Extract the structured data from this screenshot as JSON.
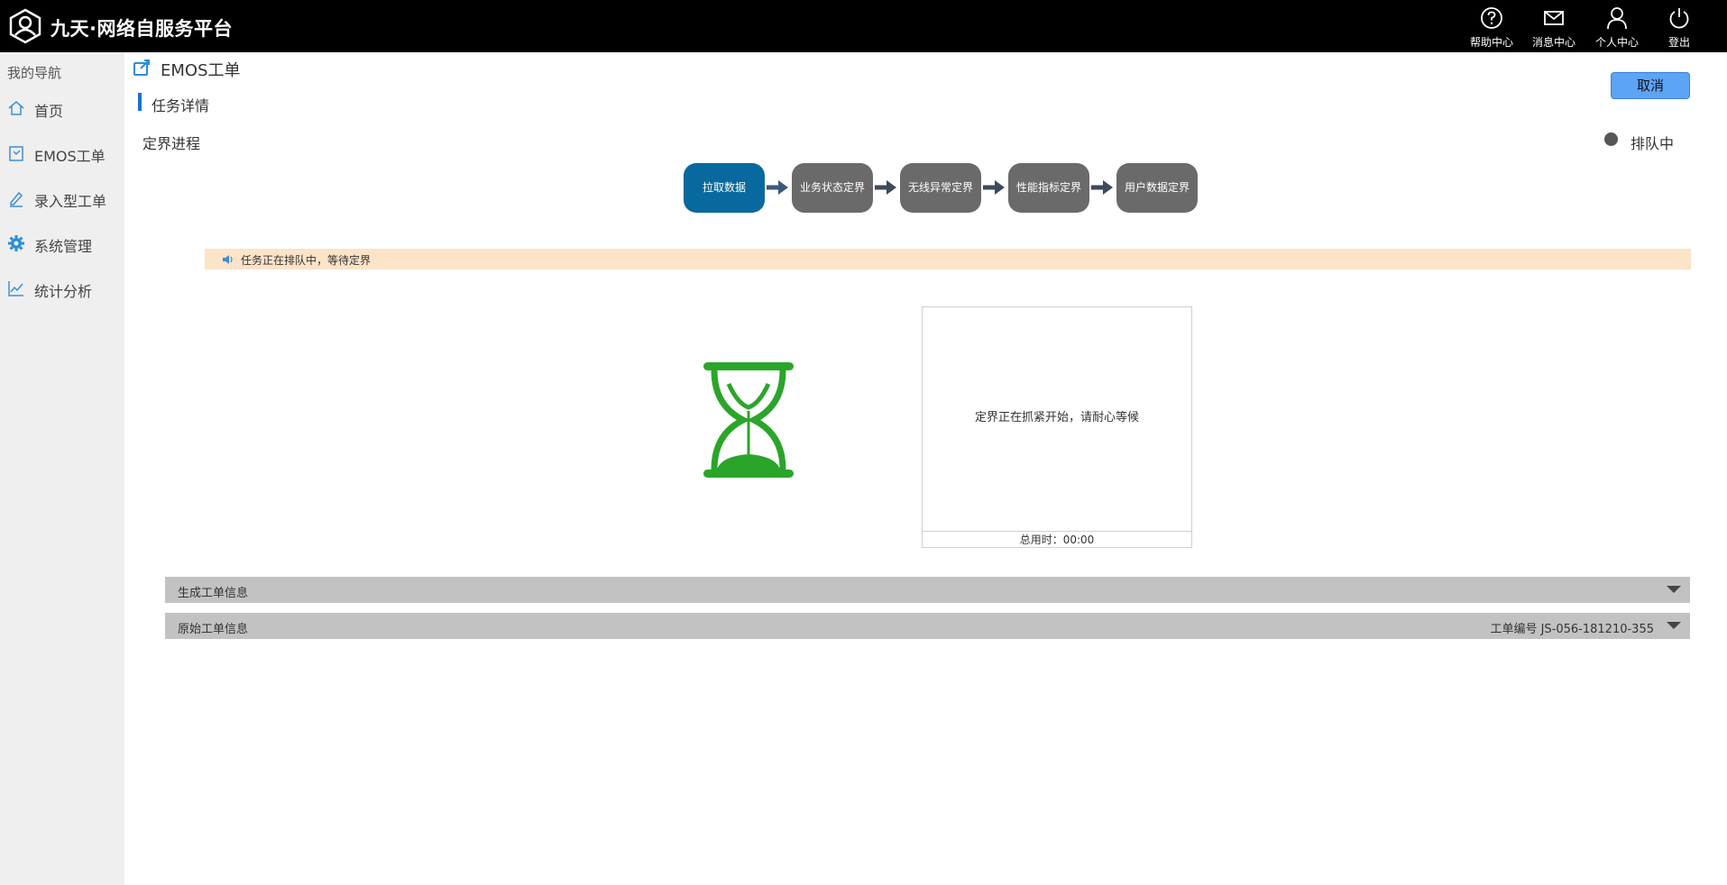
{
  "header": {
    "brand": "九天·网络自服务平台",
    "icons": [
      {
        "name": "help",
        "label": "帮助中心"
      },
      {
        "name": "message",
        "label": "消息中心"
      },
      {
        "name": "user",
        "label": "个人中心"
      },
      {
        "name": "logout",
        "label": "登出"
      }
    ]
  },
  "sidebar": {
    "title": "我的导航",
    "items": [
      {
        "label": "首页",
        "icon": "home-icon"
      },
      {
        "label": "EMOS工单",
        "icon": "ticket-icon"
      },
      {
        "label": "录入型工单",
        "icon": "edit-icon"
      },
      {
        "label": "系统管理",
        "icon": "gear-icon"
      },
      {
        "label": "统计分析",
        "icon": "chart-icon"
      }
    ]
  },
  "main": {
    "page_title": "EMOS工单",
    "cancel_label": "取消",
    "section_title": "任务详情",
    "progress_label": "定界进程",
    "status": "排队中",
    "steps": [
      "拉取数据",
      "业务状态定界",
      "无线异常定界",
      "性能指标定界",
      "用户数据定界"
    ],
    "active_step": 0,
    "notice": "任务正在排队中，等待定界",
    "wait_message": "定界正在抓紧开始，请耐心等候",
    "elapsed": "总用时：00:00",
    "panels": [
      {
        "title": "生成工单信息",
        "right": ""
      },
      {
        "title": "原始工单信息",
        "right": "工单编号 JS-056-181210-355"
      }
    ]
  },
  "colors": {
    "topbar": "#000000",
    "active_step": "#08699e",
    "step": "#6a6a6a",
    "notice_bg": "#fde3c8",
    "hourglass": "#2aa52a",
    "accent": "#1a6fd8"
  }
}
